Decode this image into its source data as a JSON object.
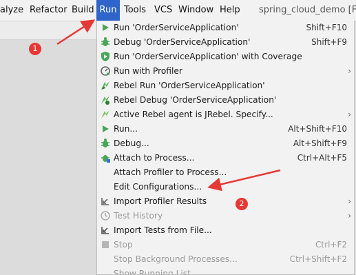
{
  "menubar": {
    "items": [
      {
        "label": "alyze"
      },
      {
        "label": "Refactor"
      },
      {
        "label": "Build"
      },
      {
        "label": "Run"
      },
      {
        "label": "Tools"
      },
      {
        "label": "VCS"
      },
      {
        "label": "Window"
      },
      {
        "label": "Help"
      }
    ],
    "window_title": "spring_cloud_demo [F:\\"
  },
  "run_menu": {
    "items": [
      {
        "label": "Run 'OrderServiceApplication'",
        "shortcut": "Shift+F10",
        "icon": "run-play-icon",
        "enabled": true
      },
      {
        "label": "Debug 'OrderServiceApplication'",
        "shortcut": "Shift+F9",
        "icon": "debug-bug-icon",
        "enabled": true
      },
      {
        "label": "Run 'OrderServiceApplication' with Coverage",
        "shortcut": "",
        "icon": "coverage-shield-icon",
        "enabled": true
      },
      {
        "label": "Run with Profiler",
        "shortcut": "",
        "icon": "profiler-icon",
        "enabled": true,
        "submenu": true
      },
      {
        "label": "Rebel Run 'OrderServiceApplication'",
        "shortcut": "",
        "icon": "jrebel-run-icon",
        "enabled": true
      },
      {
        "label": "Rebel Debug 'OrderServiceApplication'",
        "shortcut": "",
        "icon": "jrebel-debug-icon",
        "enabled": true
      },
      {
        "label": "Active Rebel agent is JRebel. Specify...",
        "shortcut": "",
        "icon": "jrebel-agent-icon",
        "enabled": true,
        "submenu": true
      },
      {
        "label": "Run...",
        "shortcut": "Alt+Shift+F10",
        "icon": "run-play-icon",
        "enabled": true
      },
      {
        "label": "Debug...",
        "shortcut": "Alt+Shift+F9",
        "icon": "debug-bug-icon",
        "enabled": true
      },
      {
        "label": "Attach to Process...",
        "shortcut": "Ctrl+Alt+F5",
        "icon": "attach-bug-icon",
        "enabled": true
      },
      {
        "label": "Attach Profiler to Process...",
        "shortcut": "",
        "icon": "",
        "enabled": true
      },
      {
        "label": "Edit Configurations...",
        "shortcut": "",
        "icon": "",
        "enabled": true
      },
      {
        "label": "Import Profiler Results",
        "shortcut": "",
        "icon": "import-results-icon",
        "enabled": true,
        "submenu": true
      },
      {
        "label": "Test History",
        "shortcut": "",
        "icon": "history-clock-icon",
        "enabled": false,
        "submenu": true
      },
      {
        "label": "Import Tests from File...",
        "shortcut": "",
        "icon": "import-tests-icon",
        "enabled": true
      },
      {
        "label": "Stop",
        "shortcut": "Ctrl+F2",
        "icon": "stop-square-icon",
        "enabled": false
      },
      {
        "label": "Stop Background Processes...",
        "shortcut": "Ctrl+Shift+F2",
        "icon": "",
        "enabled": false
      },
      {
        "label": "Show Running List",
        "shortcut": "",
        "icon": "",
        "enabled": false
      }
    ]
  },
  "annotations": {
    "marker_1": "1",
    "marker_2": "2",
    "color": "#e53935"
  },
  "colors": {
    "accent": "#2f65ca",
    "run_green": "#49a658",
    "disabled_text": "#9a9a9a"
  }
}
